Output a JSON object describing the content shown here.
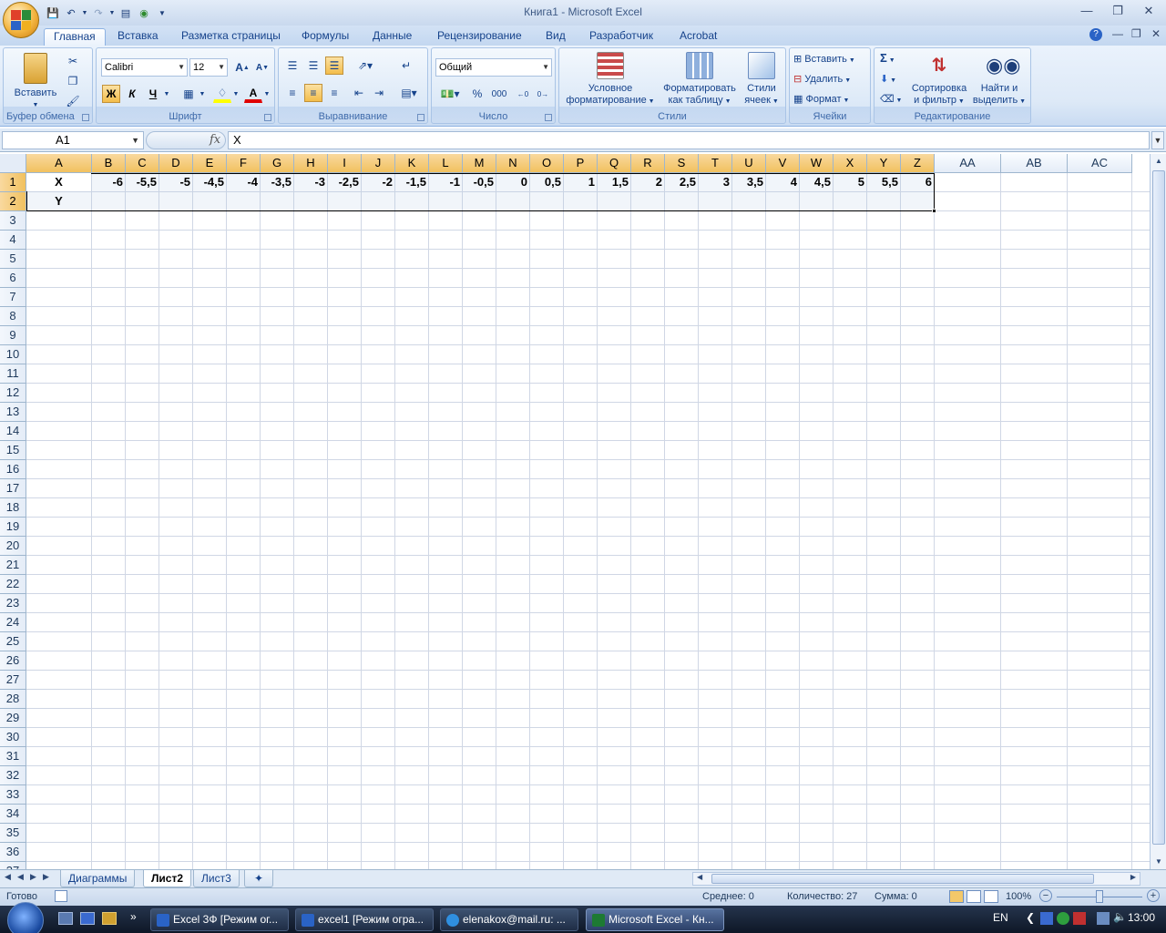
{
  "window": {
    "title": "Книга1 - Microsoft Excel"
  },
  "ribbon": {
    "tabs": [
      "Главная",
      "Вставка",
      "Разметка страницы",
      "Формулы",
      "Данные",
      "Рецензирование",
      "Вид",
      "Разработчик",
      "Acrobat"
    ],
    "active_tab": "Главная",
    "clipboard": {
      "paste_label": "Вставить",
      "group_label": "Буфер обмена"
    },
    "font": {
      "name": "Calibri",
      "size": "12",
      "bold": "Ж",
      "italic": "К",
      "underline": "Ч",
      "group_label": "Шрифт"
    },
    "alignment": {
      "group_label": "Выравнивание"
    },
    "number": {
      "format": "Общий",
      "percent": "%",
      "thousands": "000",
      "group_label": "Число"
    },
    "styles": {
      "conditional_line1": "Условное",
      "conditional_line2": "форматирование",
      "table_line1": "Форматировать",
      "table_line2": "как таблицу",
      "cell_line1": "Стили",
      "cell_line2": "ячеек",
      "group_label": "Стили"
    },
    "cells": {
      "insert": "Вставить",
      "delete": "Удалить",
      "format": "Формат",
      "group_label": "Ячейки"
    },
    "editing": {
      "sigma": "Σ",
      "sort_line1": "Сортировка",
      "sort_line2": "и фильтр",
      "find_line1": "Найти и",
      "find_line2": "выделить",
      "group_label": "Редактирование"
    }
  },
  "formula_bar": {
    "name_box": "A1",
    "fx": "fx",
    "content": "X"
  },
  "sheet": {
    "columns": [
      "A",
      "B",
      "C",
      "D",
      "E",
      "F",
      "G",
      "H",
      "I",
      "J",
      "K",
      "L",
      "M",
      "N",
      "O",
      "P",
      "Q",
      "R",
      "S",
      "T",
      "U",
      "V",
      "W",
      "X",
      "Y",
      "Z",
      "AA",
      "AB",
      "AC"
    ],
    "rows": [
      "1",
      "2",
      "3",
      "4",
      "5",
      "6",
      "7",
      "8",
      "9",
      "10",
      "11",
      "12",
      "13",
      "14",
      "15",
      "16",
      "17",
      "18",
      "19",
      "20",
      "21",
      "22",
      "23",
      "24",
      "25",
      "26",
      "27",
      "28",
      "29",
      "30",
      "31",
      "32",
      "33",
      "34",
      "35",
      "36",
      "37"
    ],
    "row1": [
      "X",
      "-6",
      "-5,5",
      "-5",
      "-4,5",
      "-4",
      "-3,5",
      "-3",
      "-2,5",
      "-2",
      "-1,5",
      "-1",
      "-0,5",
      "0",
      "0,5",
      "1",
      "1,5",
      "2",
      "2,5",
      "3",
      "3,5",
      "4",
      "4,5",
      "5",
      "5,5",
      "6"
    ],
    "row2_label": "Y"
  },
  "sheet_tabs": [
    "Диаграммы",
    "Лист2",
    "Лист3"
  ],
  "active_sheet": "Лист2",
  "status_bar": {
    "ready": "Готово",
    "average": "Среднее: 0",
    "count": "Количество: 27",
    "sum": "Сумма: 0",
    "zoom": "100%"
  },
  "taskbar": {
    "buttons": [
      "Excel 3Ф [Режим ог...",
      "excel1 [Режим огра...",
      "elenakox@mail.ru: ...",
      "Microsoft Excel - Кн..."
    ],
    "active_button": "Microsoft Excel - Кн...",
    "language": "EN",
    "clock": "13:00"
  },
  "colors": {
    "selected_header": "#f1c15f",
    "ribbon_bg": "#dde9f7",
    "grid_line": "#d0d7e5",
    "excel_green": "#1d7a33"
  }
}
